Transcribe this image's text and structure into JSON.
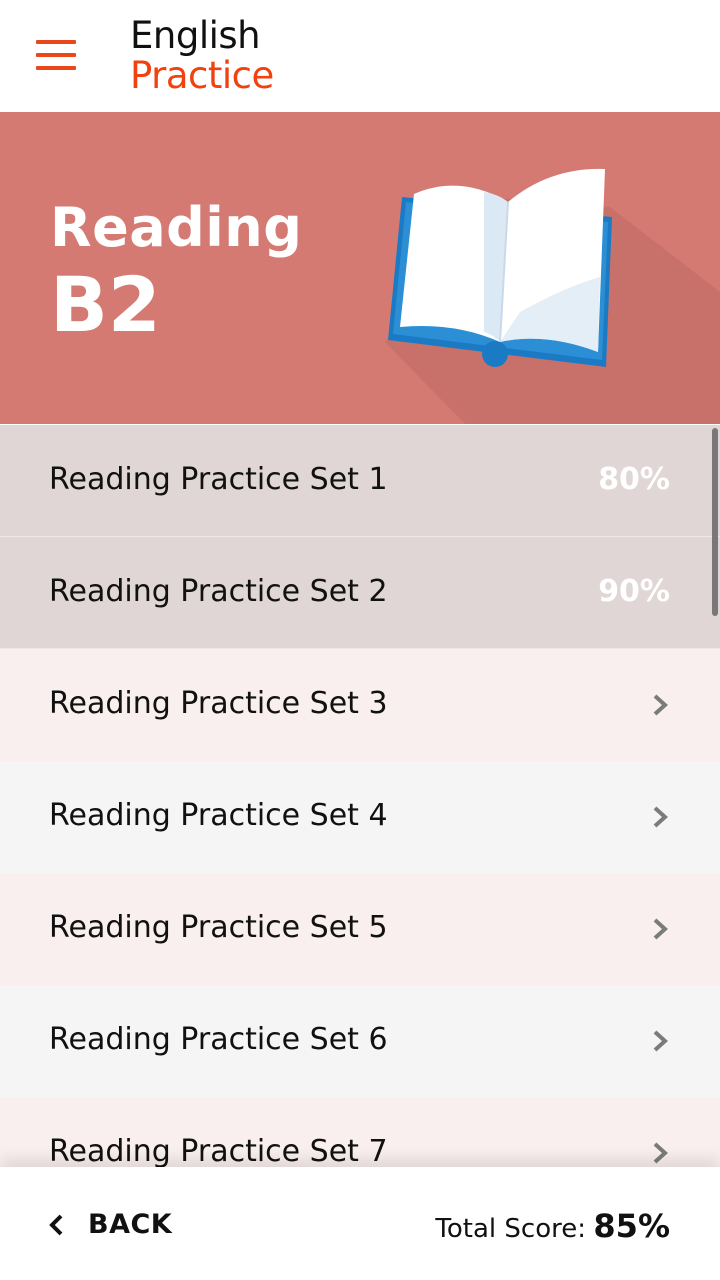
{
  "header": {
    "menu_icon": "hamburger-menu-icon",
    "logo_line1": "English",
    "logo_line2": "Practice"
  },
  "banner": {
    "title": "Reading",
    "level": "B2",
    "illustration": "open-book-icon",
    "color": "#d47a73"
  },
  "sets": [
    {
      "label": "Reading Practice Set 1",
      "score": "80%"
    },
    {
      "label": "Reading Practice Set 2",
      "score": "90%"
    },
    {
      "label": "Reading Practice Set 3"
    },
    {
      "label": "Reading Practice Set 4"
    },
    {
      "label": "Reading Practice Set 5"
    },
    {
      "label": "Reading Practice Set 6"
    },
    {
      "label": "Reading Practice Set 7"
    }
  ],
  "footer": {
    "back_icon": "chevron-left-icon",
    "back_label": "BACK",
    "total_label": "Total Score:",
    "total_value": "85%"
  },
  "colors": {
    "accent": "#f0410f",
    "completed_row": "#e0d6d5",
    "row_pink": "#f9efee",
    "row_gray": "#f5f5f5"
  }
}
